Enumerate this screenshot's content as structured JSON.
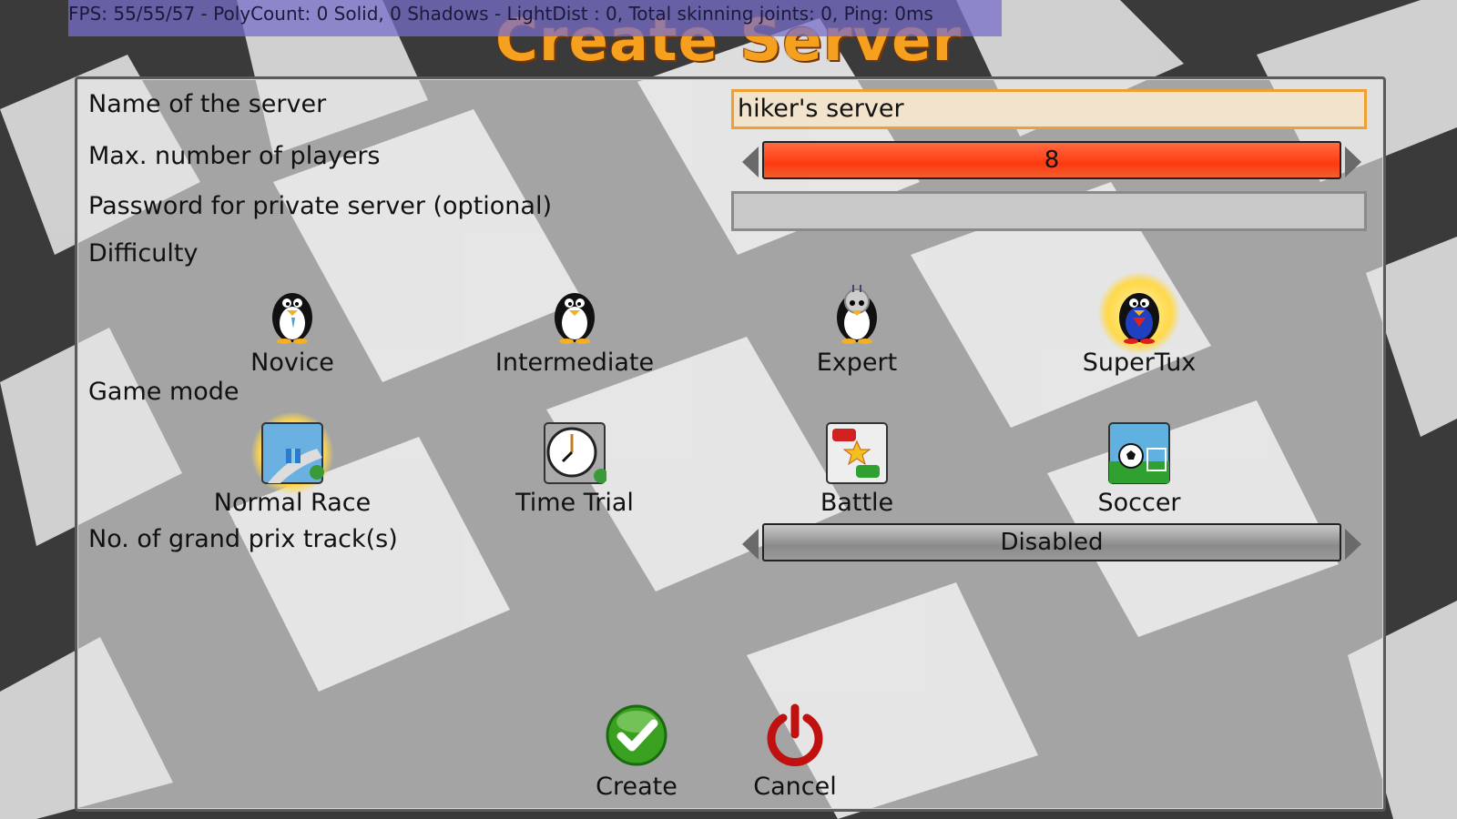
{
  "debug_overlay": "FPS: 55/55/57  - PolyCount: 0 Solid, 0 Shadows - LightDist : 0, Total skinning joints: 0, Ping: 0ms",
  "screen_title": "Create Server",
  "form": {
    "server_name_label": "Name of the server",
    "server_name_value": "hiker's server",
    "max_players_label": "Max. number of players",
    "max_players_value": "8",
    "password_label": "Password for private server (optional)",
    "password_value": "",
    "difficulty_label": "Difficulty",
    "game_mode_label": "Game mode",
    "gp_tracks_label": "No. of grand prix track(s)",
    "gp_tracks_value": "Disabled"
  },
  "difficulty_options": [
    {
      "label": "Novice",
      "icon": "penguin-novice-icon",
      "selected": false
    },
    {
      "label": "Intermediate",
      "icon": "penguin-intermediate-icon",
      "selected": false
    },
    {
      "label": "Expert",
      "icon": "penguin-expert-icon",
      "selected": false
    },
    {
      "label": "SuperTux",
      "icon": "penguin-supertux-icon",
      "selected": true
    }
  ],
  "game_mode_options": [
    {
      "label": "Normal Race",
      "icon": "normal-race-icon",
      "selected": true
    },
    {
      "label": "Time Trial",
      "icon": "clock-icon",
      "selected": false
    },
    {
      "label": "Battle",
      "icon": "battle-icon",
      "selected": false
    },
    {
      "label": "Soccer",
      "icon": "soccer-ball-icon",
      "selected": false
    }
  ],
  "actions": {
    "create_label": "Create",
    "cancel_label": "Cancel"
  },
  "colors": {
    "accent_orange": "#f6a020",
    "spinner_red": "#ff4a20",
    "focus_border": "#f0a030",
    "selection_glow": "#ffd84a"
  }
}
